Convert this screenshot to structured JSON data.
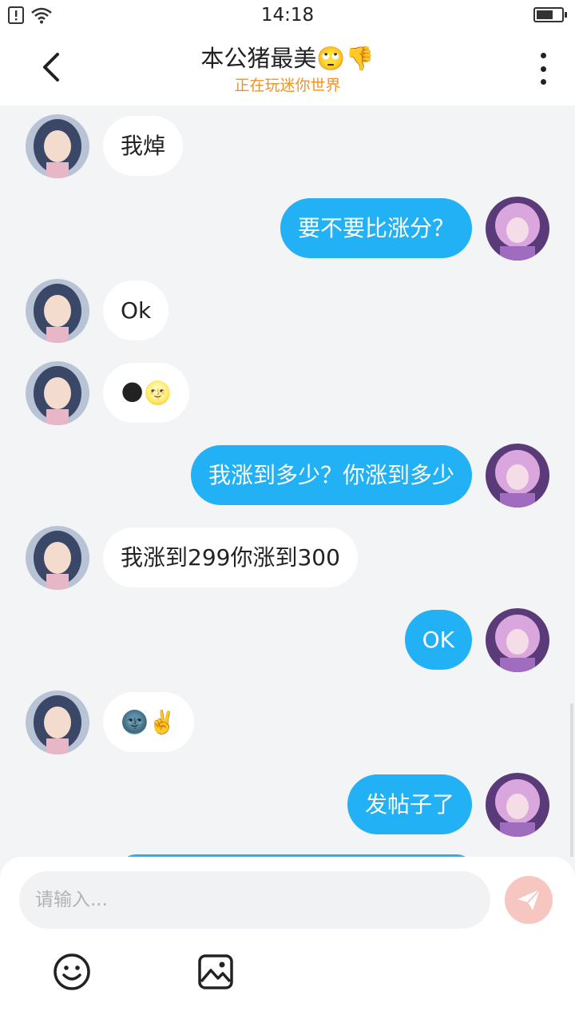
{
  "status_bar": {
    "time": "14:18",
    "icons": [
      "alert-sim-icon",
      "wifi-icon",
      "battery-icon"
    ]
  },
  "header": {
    "title": "本公猪最美",
    "title_emojis": [
      "🙄",
      "👎"
    ],
    "subtitle": "正在玩迷你世界",
    "icons": [
      "back-icon",
      "more-icon"
    ]
  },
  "messages": [
    {
      "side": "left",
      "text": "我焯"
    },
    {
      "side": "right",
      "text": "要不要比涨分？"
    },
    {
      "side": "left",
      "text": "Ok"
    },
    {
      "side": "left",
      "text": "🌑🌝"
    },
    {
      "side": "right",
      "text": "我涨到多少？你涨到多少"
    },
    {
      "side": "left",
      "text": "我涨到299你涨到300"
    },
    {
      "side": "right",
      "text": "OK"
    },
    {
      "side": "left",
      "text": "🌚✌️"
    },
    {
      "side": "right",
      "text": "发帖子了"
    }
  ],
  "composer": {
    "placeholder": "请输入...",
    "send_icon": "send-icon",
    "tools": [
      "emoji-icon",
      "image-icon"
    ]
  },
  "colors": {
    "outgoing_bubble": "#22b1f5",
    "incoming_bubble": "#ffffff",
    "chat_background": "#f3f4f6",
    "subtitle": "#f39224",
    "send_button": "#f8c6c0"
  }
}
